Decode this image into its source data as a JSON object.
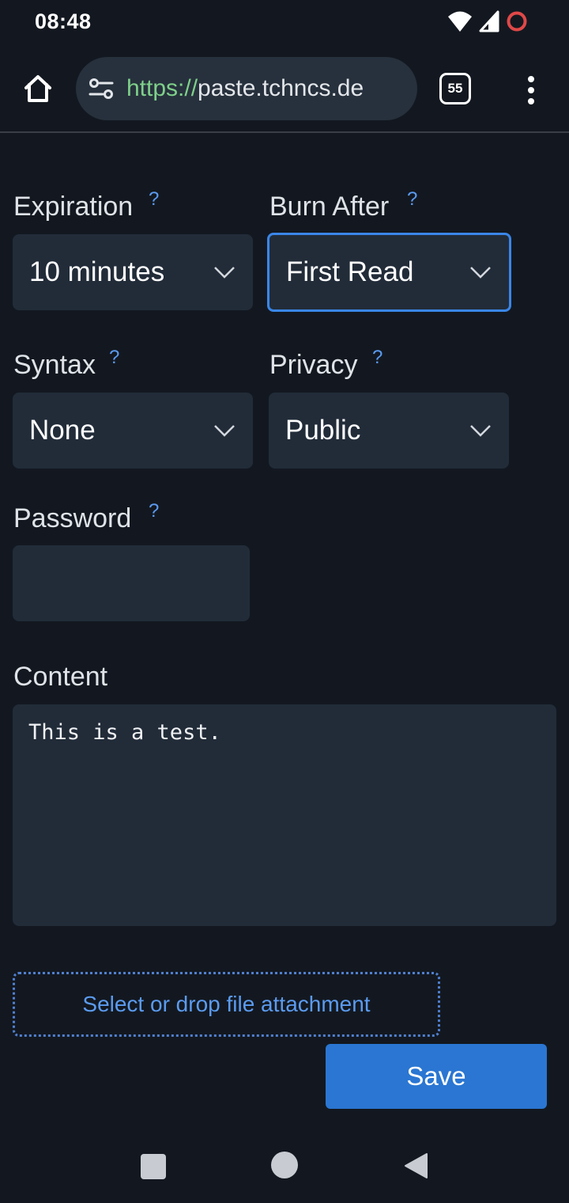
{
  "status_bar": {
    "time": "08:48",
    "icons": [
      "wifi-icon",
      "signal-icon",
      "battery-ring-icon"
    ]
  },
  "browser": {
    "url_scheme": "https://",
    "url_host": "paste.tchncs.de",
    "tab_count": "55",
    "icons": [
      "home-icon",
      "site-settings-icon",
      "tabs-icon",
      "more-vert-icon"
    ]
  },
  "form": {
    "expiration": {
      "label": "Expiration",
      "help": "?",
      "value": "10 minutes"
    },
    "burn_after": {
      "label": "Burn After",
      "help": "?",
      "value": "First Read"
    },
    "syntax": {
      "label": "Syntax",
      "help": "?",
      "value": "None"
    },
    "privacy": {
      "label": "Privacy",
      "help": "?",
      "value": "Public"
    },
    "password": {
      "label": "Password",
      "help": "?",
      "value": ""
    },
    "content": {
      "label": "Content",
      "value": "This is a test."
    },
    "attachment_label": "Select or drop file attachment",
    "save_label": "Save"
  },
  "colors": {
    "background": "#131820",
    "field": "#222c39",
    "accent": "#2a76d2",
    "help": "#5b9bf0",
    "url_scheme": "#7fd08a"
  },
  "nav_bar": {
    "icons": [
      "recents-square-icon",
      "home-circle-icon",
      "back-triangle-icon"
    ]
  }
}
